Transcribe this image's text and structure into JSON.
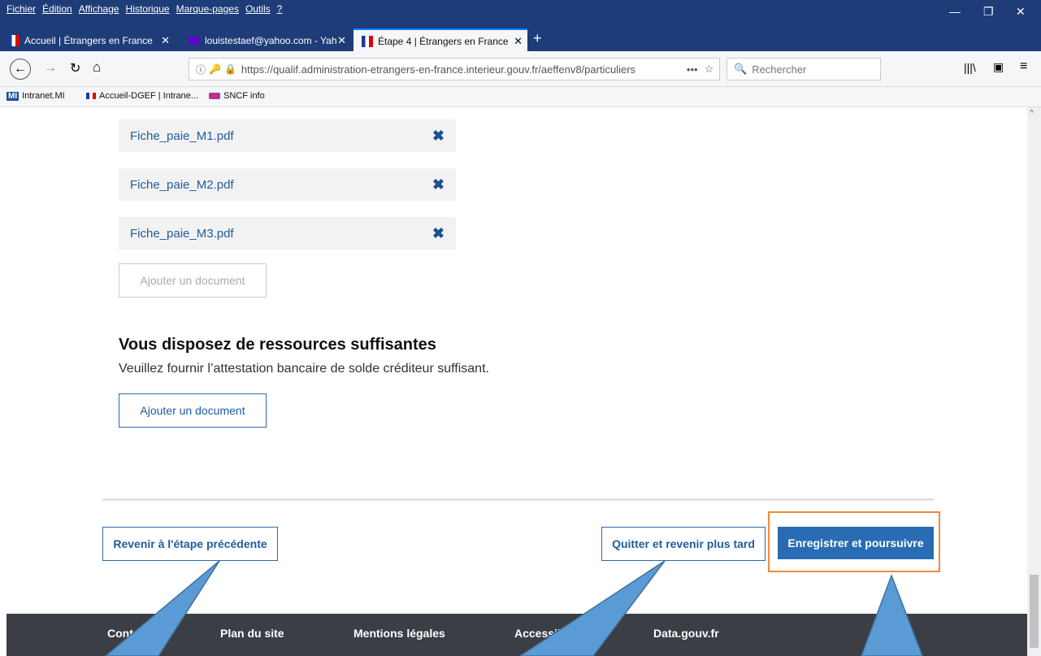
{
  "menu": [
    "Fichier",
    "Édition",
    "Affichage",
    "Historique",
    "Marque-pages",
    "Outils",
    "?"
  ],
  "tabs": [
    {
      "label": "Accueil | Étrangers en France",
      "icon": "fr-flag-icon"
    },
    {
      "label": "louistestaef@yahoo.com - Yah",
      "icon": "yahoo-mail-icon"
    },
    {
      "label": "Étape 4 | Étrangers en France",
      "icon": "fr-flag-icon",
      "active": true
    }
  ],
  "url": "https://qualif.administration-etrangers-en-france.interieur.gouv.fr/aeffenv8/particuliers",
  "search_placeholder": "Rechercher",
  "bookmarks": [
    "Intranet.MI",
    "Accueil-DGEF | Intrane...",
    "SNCF info"
  ],
  "files": [
    "Fiche_paie_M1.pdf",
    "Fiche_paie_M2.pdf",
    "Fiche_paie_M3.pdf"
  ],
  "add_document_disabled": "Ajouter un document",
  "resources": {
    "title": "Vous disposez de ressources suffisantes",
    "text": "Veuillez fournir l’attestation bancaire de solde créditeur suffisant.",
    "add_document": "Ajouter un document"
  },
  "nav": {
    "previous": "Revenir à l'étape précédente",
    "quit": "Quitter et revenir plus tard",
    "save": "Enregistrer et poursuivre"
  },
  "footer": [
    "Contact",
    "Plan du site",
    "Mentions légales",
    "Accessibilité",
    "Data.gouv.fr"
  ],
  "colors": {
    "accent": "#2a6cb3",
    "highlight": "#ef8a3a",
    "footer": "#3b3e45",
    "arrow": "#5b9bd5"
  }
}
